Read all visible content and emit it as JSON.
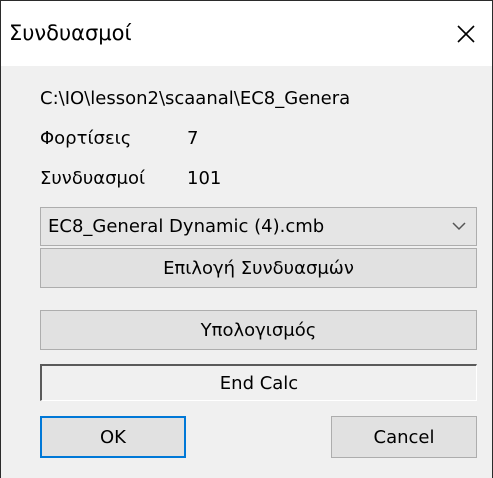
{
  "window": {
    "title": "Συνδυασμοί",
    "close_icon": "close-icon"
  },
  "info": {
    "path": "C:\\IO\\lesson2\\scaanal\\EC8_Genera",
    "loads_label": "Φορτίσεις",
    "loads_value": "7",
    "combos_label": "Συνδυασμοί",
    "combos_value": "101"
  },
  "combo_select": {
    "selected": "EC8_General Dynamic (4).cmb",
    "arrow_icon": "chevron-down-icon"
  },
  "buttons": {
    "select_combinations": "Επιλογή Συνδυασμών",
    "calculate": "Υπολογισμός",
    "ok": "OK",
    "cancel": "Cancel"
  },
  "status": {
    "text": "End Calc"
  },
  "colors": {
    "client_bg": "#f0f0f0",
    "button_bg": "#e1e1e1",
    "button_border": "#adadad",
    "default_button_border": "#0078d7"
  }
}
